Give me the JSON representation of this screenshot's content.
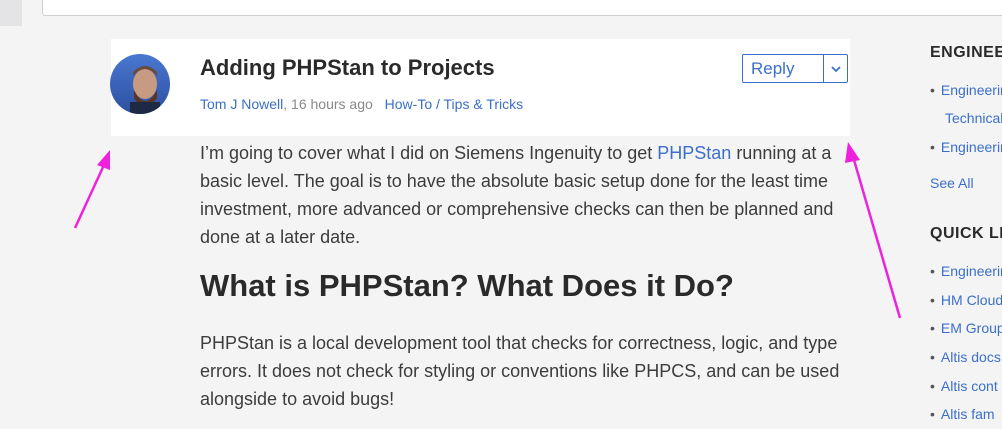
{
  "post": {
    "title": "Adding PHPStan to Projects",
    "author": "Tom J Nowell",
    "time": ", 16 hours ago",
    "category": "How-To / Tips & Tricks",
    "reply_label": "Reply"
  },
  "content": {
    "p1_before": "I’m going to cover what I did on Siemens Ingenuity to get ",
    "p1_link": "PHPStan",
    "p1_after": " running at a basic level. The goal is to have the absolute basic setup done for the least time investment, more advanced or comprehensive checks can then be planned and done at a later date.",
    "heading": "What is PHPStan? What Does it Do?",
    "p2": "PHPStan is a local development tool that checks for correctness, logic, and type errors. It does not check for styling or conventions like PHPCS, and can be used alongside to avoid bugs!"
  },
  "sidebar": {
    "heading1": "ENGINEERING",
    "items1": [
      "Engineering",
      "Technical",
      "Engineering"
    ],
    "see_all": "See All",
    "heading2": "QUICK LINKS",
    "items2": [
      "Engineering",
      "HM Cloud",
      "EM Group",
      "Altis docs",
      "Altis cont",
      "Altis fam"
    ]
  },
  "colors": {
    "accent": "#3b6fc8",
    "annotation_arrow": "#ee22dd"
  }
}
